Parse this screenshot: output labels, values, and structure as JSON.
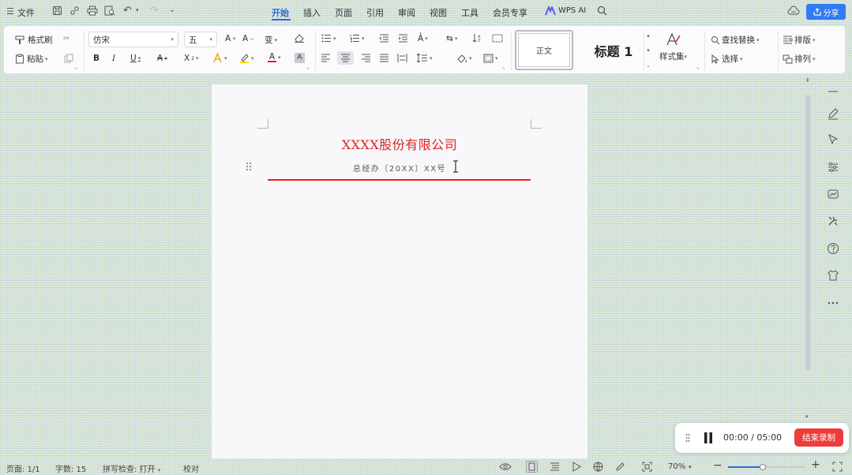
{
  "topbar": {
    "file_label": "文件",
    "tabs": [
      {
        "label": "开始",
        "active": true
      },
      {
        "label": "插入"
      },
      {
        "label": "页面"
      },
      {
        "label": "引用"
      },
      {
        "label": "审阅"
      },
      {
        "label": "视图"
      },
      {
        "label": "工具"
      },
      {
        "label": "会员专享"
      }
    ],
    "wps_ai_label": "WPS AI",
    "share_label": "分享"
  },
  "ribbon": {
    "format_painter_label": "格式刷",
    "paste_label": "粘贴",
    "font_name": "仿宋",
    "font_size": "五",
    "style_normal_label": "正文",
    "style_heading_label": "标题 1",
    "styles_label": "样式集",
    "find_replace_label": "查找替换",
    "select_label": "选择",
    "layout_label": "排版",
    "arrange_label": "排列"
  },
  "document": {
    "company_title": "XXXX股份有限公司",
    "doc_number": "总经办〔20XX〕XX号"
  },
  "recording": {
    "time": "00:00 / 05:00",
    "end_label": "结束录制"
  },
  "statusbar": {
    "page": "页面: 1/1",
    "word_count": "字数: 15",
    "spell_check": "拼写检查: 打开",
    "proofread": "校对",
    "zoom": "70%",
    "zoom_level": 0.45
  },
  "colors": {
    "accent": "#2a6bd6",
    "red_heading": "#e02020",
    "record_button": "#ee3c3c"
  }
}
